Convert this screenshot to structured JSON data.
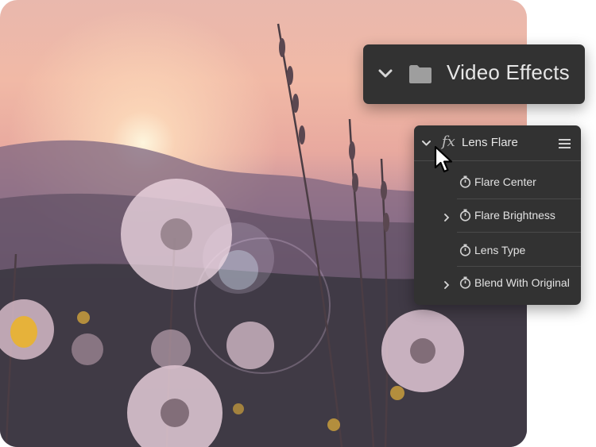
{
  "video_effects": {
    "title": "Video Effects",
    "icons": [
      "chevron-down-icon",
      "folder-icon"
    ]
  },
  "lens_flare": {
    "title": "Lens Flare",
    "fx_glyph": "fx",
    "icons": [
      "chevron-down-icon",
      "fx-icon",
      "hamburger-menu-icon"
    ],
    "properties": [
      {
        "label": "Flare Center",
        "expandable": false
      },
      {
        "label": "Flare Brightness",
        "expandable": true
      },
      {
        "label": "Lens Type",
        "expandable": false
      },
      {
        "label": "Blend With Original",
        "expandable": true
      }
    ]
  },
  "colors": {
    "panel_bg": "#323232",
    "panel_text": "#e6e6e6",
    "divider": "#4a4a4a",
    "icon_grey": "#bdbdbd"
  }
}
